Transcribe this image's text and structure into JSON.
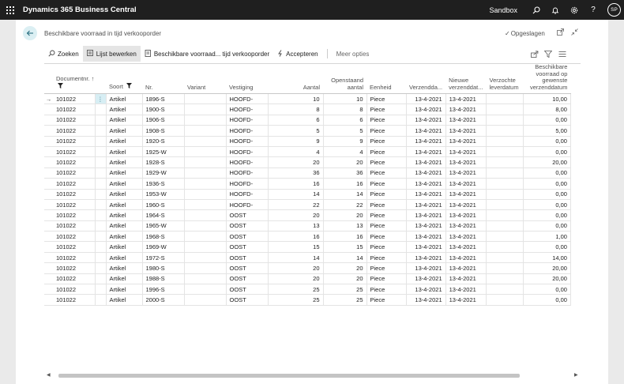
{
  "topbar": {
    "app_title": "Dynamics 365 Business Central",
    "environment": "Sandbox",
    "avatar_initials": "SP"
  },
  "page": {
    "title": "Beschikbare voorraad in tijd verkooporder",
    "saved_label": "Opgeslagen"
  },
  "actions": {
    "search": "Zoeken",
    "edit_list": "Lijst bewerken",
    "availability": "Beschikbare voorraad... tijd verkooporder",
    "accept": "Accepteren",
    "more": "Meer opties"
  },
  "columns": {
    "document_no": "Documentnr.",
    "document_no_sort": "↑",
    "type": "Soort",
    "no": "Nr.",
    "variant": "Variant",
    "location": "Vestiging",
    "quantity": "Aantal",
    "outstanding": "Openstaand aantal",
    "unit": "Eenheid",
    "shipment_date": "Verzendda...",
    "new_shipment_date": "Nieuwe verzenddat...",
    "requested_delivery": "Verzochte leverdatum",
    "available_qty": "Beschikbare voorraad op gewenste verzenddatum"
  },
  "rows": [
    {
      "doc": "101022",
      "type": "Artikel",
      "no": "1896-S",
      "variant": "",
      "loc": "HOOFD-",
      "qty": "10",
      "out": "10",
      "unit": "Piece",
      "ship": "13-4-2021",
      "newship": "13-4-2021",
      "req": "",
      "avail": "10,00"
    },
    {
      "doc": "101022",
      "type": "Artikel",
      "no": "1900-S",
      "variant": "",
      "loc": "HOOFD-",
      "qty": "8",
      "out": "8",
      "unit": "Piece",
      "ship": "13-4-2021",
      "newship": "13-4-2021",
      "req": "",
      "avail": "8,00"
    },
    {
      "doc": "101022",
      "type": "Artikel",
      "no": "1906-S",
      "variant": "",
      "loc": "HOOFD-",
      "qty": "6",
      "out": "6",
      "unit": "Piece",
      "ship": "13-4-2021",
      "newship": "13-4-2021",
      "req": "",
      "avail": "0,00"
    },
    {
      "doc": "101022",
      "type": "Artikel",
      "no": "1908-S",
      "variant": "",
      "loc": "HOOFD-",
      "qty": "5",
      "out": "5",
      "unit": "Piece",
      "ship": "13-4-2021",
      "newship": "13-4-2021",
      "req": "",
      "avail": "5,00"
    },
    {
      "doc": "101022",
      "type": "Artikel",
      "no": "1920-S",
      "variant": "",
      "loc": "HOOFD-",
      "qty": "9",
      "out": "9",
      "unit": "Piece",
      "ship": "13-4-2021",
      "newship": "13-4-2021",
      "req": "",
      "avail": "0,00"
    },
    {
      "doc": "101022",
      "type": "Artikel",
      "no": "1925-W",
      "variant": "",
      "loc": "HOOFD-",
      "qty": "4",
      "out": "4",
      "unit": "Piece",
      "ship": "13-4-2021",
      "newship": "13-4-2021",
      "req": "",
      "avail": "0,00"
    },
    {
      "doc": "101022",
      "type": "Artikel",
      "no": "1928-S",
      "variant": "",
      "loc": "HOOFD-",
      "qty": "20",
      "out": "20",
      "unit": "Piece",
      "ship": "13-4-2021",
      "newship": "13-4-2021",
      "req": "",
      "avail": "20,00"
    },
    {
      "doc": "101022",
      "type": "Artikel",
      "no": "1929-W",
      "variant": "",
      "loc": "HOOFD-",
      "qty": "36",
      "out": "36",
      "unit": "Piece",
      "ship": "13-4-2021",
      "newship": "13-4-2021",
      "req": "",
      "avail": "0,00"
    },
    {
      "doc": "101022",
      "type": "Artikel",
      "no": "1936-S",
      "variant": "",
      "loc": "HOOFD-",
      "qty": "16",
      "out": "16",
      "unit": "Piece",
      "ship": "13-4-2021",
      "newship": "13-4-2021",
      "req": "",
      "avail": "0,00"
    },
    {
      "doc": "101022",
      "type": "Artikel",
      "no": "1953-W",
      "variant": "",
      "loc": "HOOFD-",
      "qty": "14",
      "out": "14",
      "unit": "Piece",
      "ship": "13-4-2021",
      "newship": "13-4-2021",
      "req": "",
      "avail": "0,00"
    },
    {
      "doc": "101022",
      "type": "Artikel",
      "no": "1960-S",
      "variant": "",
      "loc": "HOOFD-",
      "qty": "22",
      "out": "22",
      "unit": "Piece",
      "ship": "13-4-2021",
      "newship": "13-4-2021",
      "req": "",
      "avail": "0,00"
    },
    {
      "doc": "101022",
      "type": "Artikel",
      "no": "1964-S",
      "variant": "",
      "loc": "OOST",
      "qty": "20",
      "out": "20",
      "unit": "Piece",
      "ship": "13-4-2021",
      "newship": "13-4-2021",
      "req": "",
      "avail": "0,00"
    },
    {
      "doc": "101022",
      "type": "Artikel",
      "no": "1965-W",
      "variant": "",
      "loc": "OOST",
      "qty": "13",
      "out": "13",
      "unit": "Piece",
      "ship": "13-4-2021",
      "newship": "13-4-2021",
      "req": "",
      "avail": "0,00"
    },
    {
      "doc": "101022",
      "type": "Artikel",
      "no": "1968-S",
      "variant": "",
      "loc": "OOST",
      "qty": "16",
      "out": "16",
      "unit": "Piece",
      "ship": "13-4-2021",
      "newship": "13-4-2021",
      "req": "",
      "avail": "1,00"
    },
    {
      "doc": "101022",
      "type": "Artikel",
      "no": "1969-W",
      "variant": "",
      "loc": "OOST",
      "qty": "15",
      "out": "15",
      "unit": "Piece",
      "ship": "13-4-2021",
      "newship": "13-4-2021",
      "req": "",
      "avail": "0,00"
    },
    {
      "doc": "101022",
      "type": "Artikel",
      "no": "1972-S",
      "variant": "",
      "loc": "OOST",
      "qty": "14",
      "out": "14",
      "unit": "Piece",
      "ship": "13-4-2021",
      "newship": "13-4-2021",
      "req": "",
      "avail": "14,00"
    },
    {
      "doc": "101022",
      "type": "Artikel",
      "no": "1980-S",
      "variant": "",
      "loc": "OOST",
      "qty": "20",
      "out": "20",
      "unit": "Piece",
      "ship": "13-4-2021",
      "newship": "13-4-2021",
      "req": "",
      "avail": "20,00"
    },
    {
      "doc": "101022",
      "type": "Artikel",
      "no": "1988-S",
      "variant": "",
      "loc": "OOST",
      "qty": "20",
      "out": "20",
      "unit": "Piece",
      "ship": "13-4-2021",
      "newship": "13-4-2021",
      "req": "",
      "avail": "20,00"
    },
    {
      "doc": "101022",
      "type": "Artikel",
      "no": "1996-S",
      "variant": "",
      "loc": "OOST",
      "qty": "25",
      "out": "25",
      "unit": "Piece",
      "ship": "13-4-2021",
      "newship": "13-4-2021",
      "req": "",
      "avail": "0,00"
    },
    {
      "doc": "101022",
      "type": "Artikel",
      "no": "2000-S",
      "variant": "",
      "loc": "OOST",
      "qty": "25",
      "out": "25",
      "unit": "Piece",
      "ship": "13-4-2021",
      "newship": "13-4-2021",
      "req": "",
      "avail": "0,00"
    }
  ],
  "selected_row": 0,
  "icons": {
    "waffle": "app-launcher-icon",
    "search": "search-icon",
    "bell": "bell-icon",
    "settings": "gear-icon",
    "help": "help-icon",
    "back": "back-arrow-icon",
    "filter": "filter-icon",
    "share": "share-icon",
    "list": "list-icon"
  },
  "colors": {
    "topbar": "#1f1f1f",
    "accent": "#2a6f81",
    "accent_light": "#dbeff3",
    "row_menu_highlight": "#d7eef4"
  }
}
